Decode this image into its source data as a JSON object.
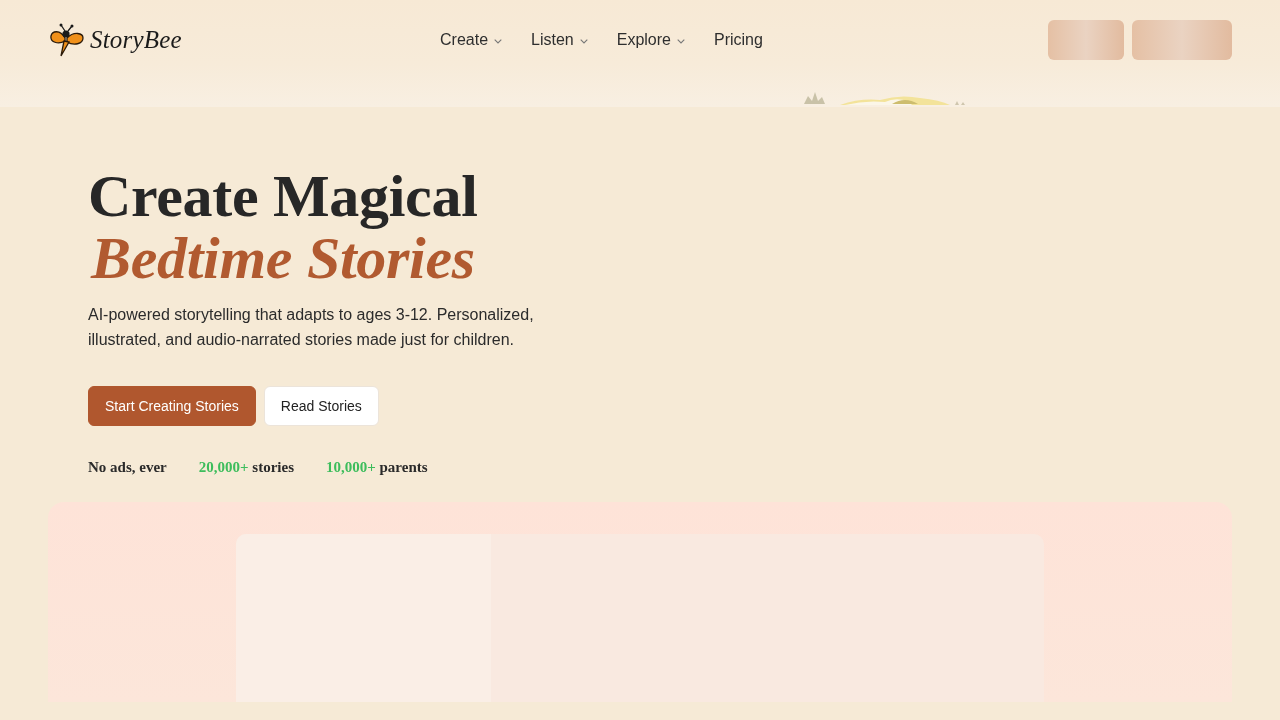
{
  "brand": {
    "name": "StoryBee"
  },
  "nav": [
    {
      "label": "Create",
      "kind": "dropdown"
    },
    {
      "label": "Listen",
      "kind": "dropdown"
    },
    {
      "label": "Explore",
      "kind": "dropdown"
    },
    {
      "label": "Pricing",
      "kind": "link"
    }
  ],
  "header_actions": [
    {
      "kind": "skeleton"
    },
    {
      "kind": "skeleton"
    }
  ],
  "hero": {
    "title": "Create Magical",
    "title_accent": "Bedtime Stories",
    "description": "AI-powered storytelling that adapts to ages 3-12. Personalized, illustrated, and audio-narrated stories made just for children.",
    "buttons": [
      {
        "label": "Start Creating Stories",
        "kind": "primary"
      },
      {
        "label": "Read Stories",
        "kind": "secondary"
      }
    ],
    "stats": [
      {
        "label": "No ads, ever"
      },
      {
        "value": "20,000+",
        "label": "stories"
      },
      {
        "value": "10,000+",
        "label": "parents"
      }
    ]
  }
}
